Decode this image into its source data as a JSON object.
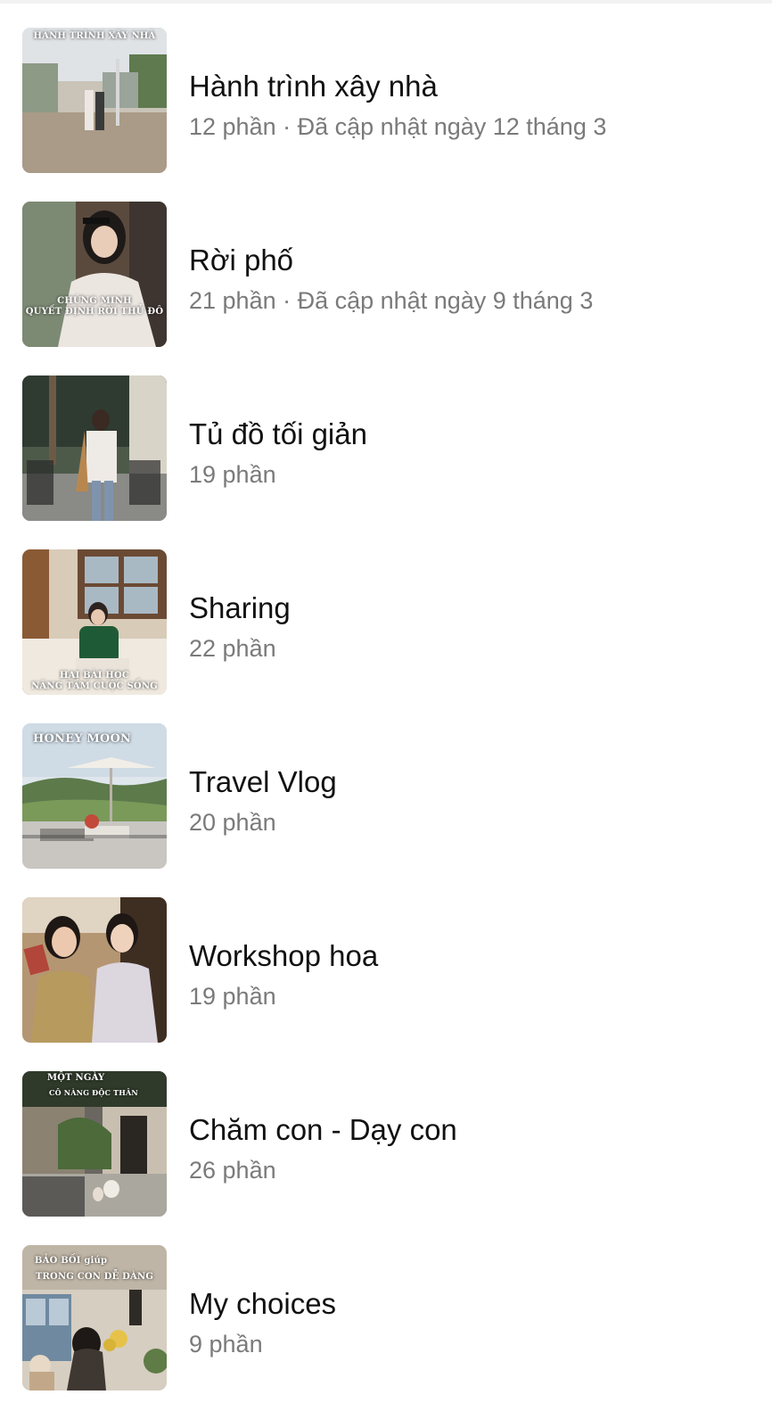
{
  "series_list": [
    {
      "title": "Hành trình xây nhà",
      "subtitle": "12 phần · Đã cập nhật ngày 12 tháng 3",
      "thumb_caption": "HÀNH TRÌNH XÂY NHÀ",
      "thumb_caption_2": ""
    },
    {
      "title": "Rời phố",
      "subtitle": "21 phần · Đã cập nhật ngày 9 tháng 3",
      "thumb_caption": "CHỨNG MINH",
      "thumb_caption_2": "QUYẾT ĐỊNH RỜI THỦ ĐÔ"
    },
    {
      "title": "Tủ đồ tối giản",
      "subtitle": "19 phần",
      "thumb_caption": "",
      "thumb_caption_2": ""
    },
    {
      "title": "Sharing",
      "subtitle": "22 phần",
      "thumb_caption": "HAI BÀI HỌC",
      "thumb_caption_2": "NÂNG TẦM CUỘC SỐNG"
    },
    {
      "title": "Travel Vlog",
      "subtitle": "20 phần",
      "thumb_caption": "HONEY MOON",
      "thumb_caption_2": ""
    },
    {
      "title": "Workshop hoa",
      "subtitle": "19 phần",
      "thumb_caption": "",
      "thumb_caption_2": ""
    },
    {
      "title": "Chăm con - Dạy con",
      "subtitle": "26 phần",
      "thumb_caption": "MỘT NGÀY",
      "thumb_caption_2": "CÔ NÀNG ĐỘC THÂN"
    },
    {
      "title": "My choices",
      "subtitle": "9 phần",
      "thumb_caption": "BẢO BỐI giúp",
      "thumb_caption_2": "TRONG CON DỄ DÀNG"
    }
  ]
}
